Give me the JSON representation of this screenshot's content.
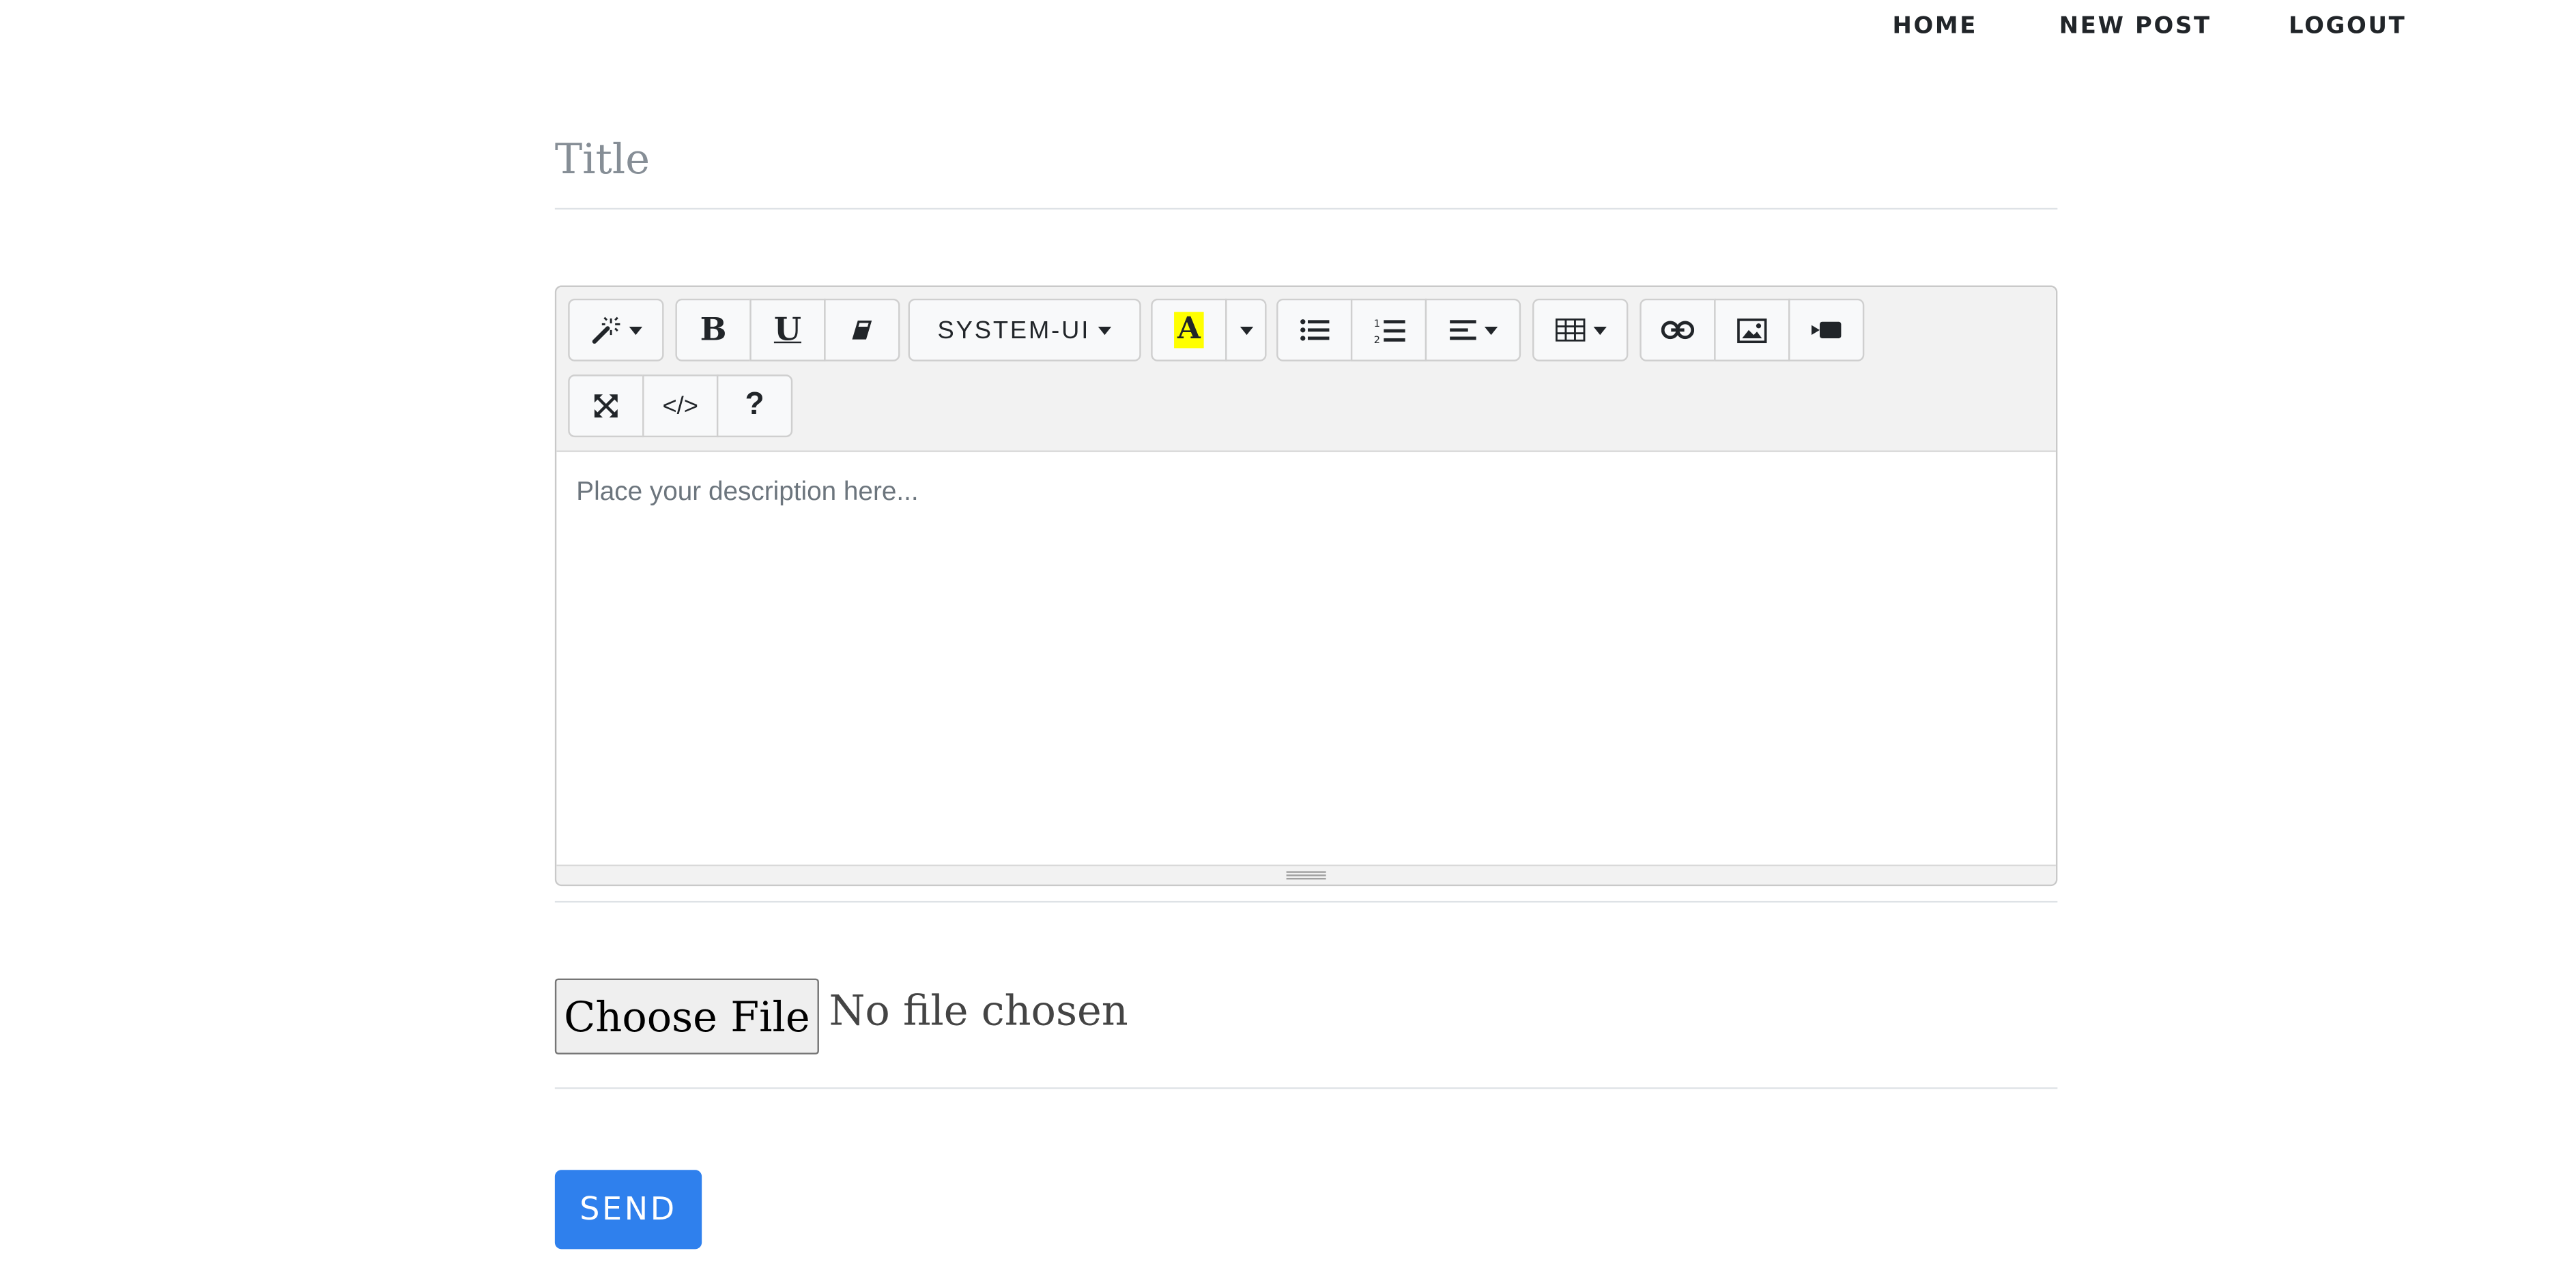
{
  "nav": {
    "home": "HOME",
    "new_post": "NEW POST",
    "logout": "LOGOUT"
  },
  "form": {
    "title_placeholder": "Title",
    "description_placeholder": "Place your description here...",
    "file_button": "Choose File",
    "file_status": "No file chosen",
    "send_button": "SEND"
  },
  "toolbar": {
    "style_icon": "magic-wand-icon",
    "bold_label": "B",
    "underline_label": "U",
    "eraser_icon": "eraser-icon",
    "font_name": "SYSTEM-UI",
    "highlight_label": "A",
    "highlight_color": "#ffff00",
    "unordered_list_icon": "unordered-list-icon",
    "ordered_list_icon": "ordered-list-icon",
    "align_icon": "align-left-icon",
    "table_icon": "table-icon",
    "link_icon": "link-icon",
    "picture_icon": "picture-icon",
    "video_icon": "video-icon",
    "fullscreen_icon": "fullscreen-icon",
    "codeview_label": "</>",
    "help_label": "?"
  },
  "colors": {
    "accent": "#2f80ed",
    "toolbar_bg": "#f2f2f2"
  }
}
